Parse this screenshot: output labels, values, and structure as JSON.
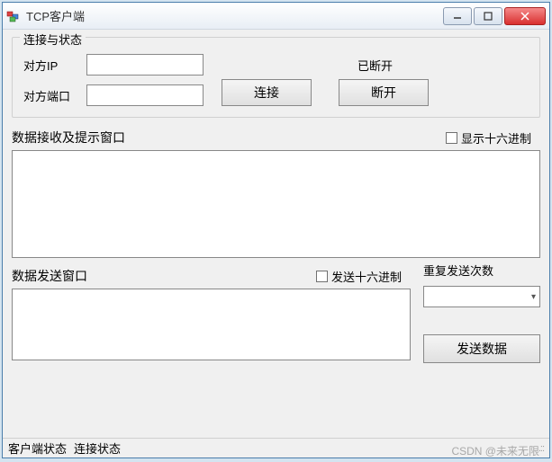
{
  "window": {
    "title": "TCP客户端"
  },
  "connection": {
    "groupTitle": "连接与状态",
    "ipLabel": "对方IP",
    "portLabel": "对方端口",
    "ipValue": "",
    "portValue": "",
    "statusText": "已断开",
    "connectBtn": "连接",
    "disconnectBtn": "断开"
  },
  "receive": {
    "title": "数据接收及提示窗口",
    "hexCheckbox": "显示十六进制",
    "content": ""
  },
  "send": {
    "title": "数据发送窗口",
    "hexCheckbox": "发送十六进制",
    "content": "",
    "repeatLabel": "重复发送次数",
    "repeatValue": "",
    "sendBtn": "发送数据"
  },
  "statusbar": {
    "clientStatus": "客户端状态",
    "connectStatus": "连接状态"
  },
  "watermark": "CSDN @未来无限"
}
